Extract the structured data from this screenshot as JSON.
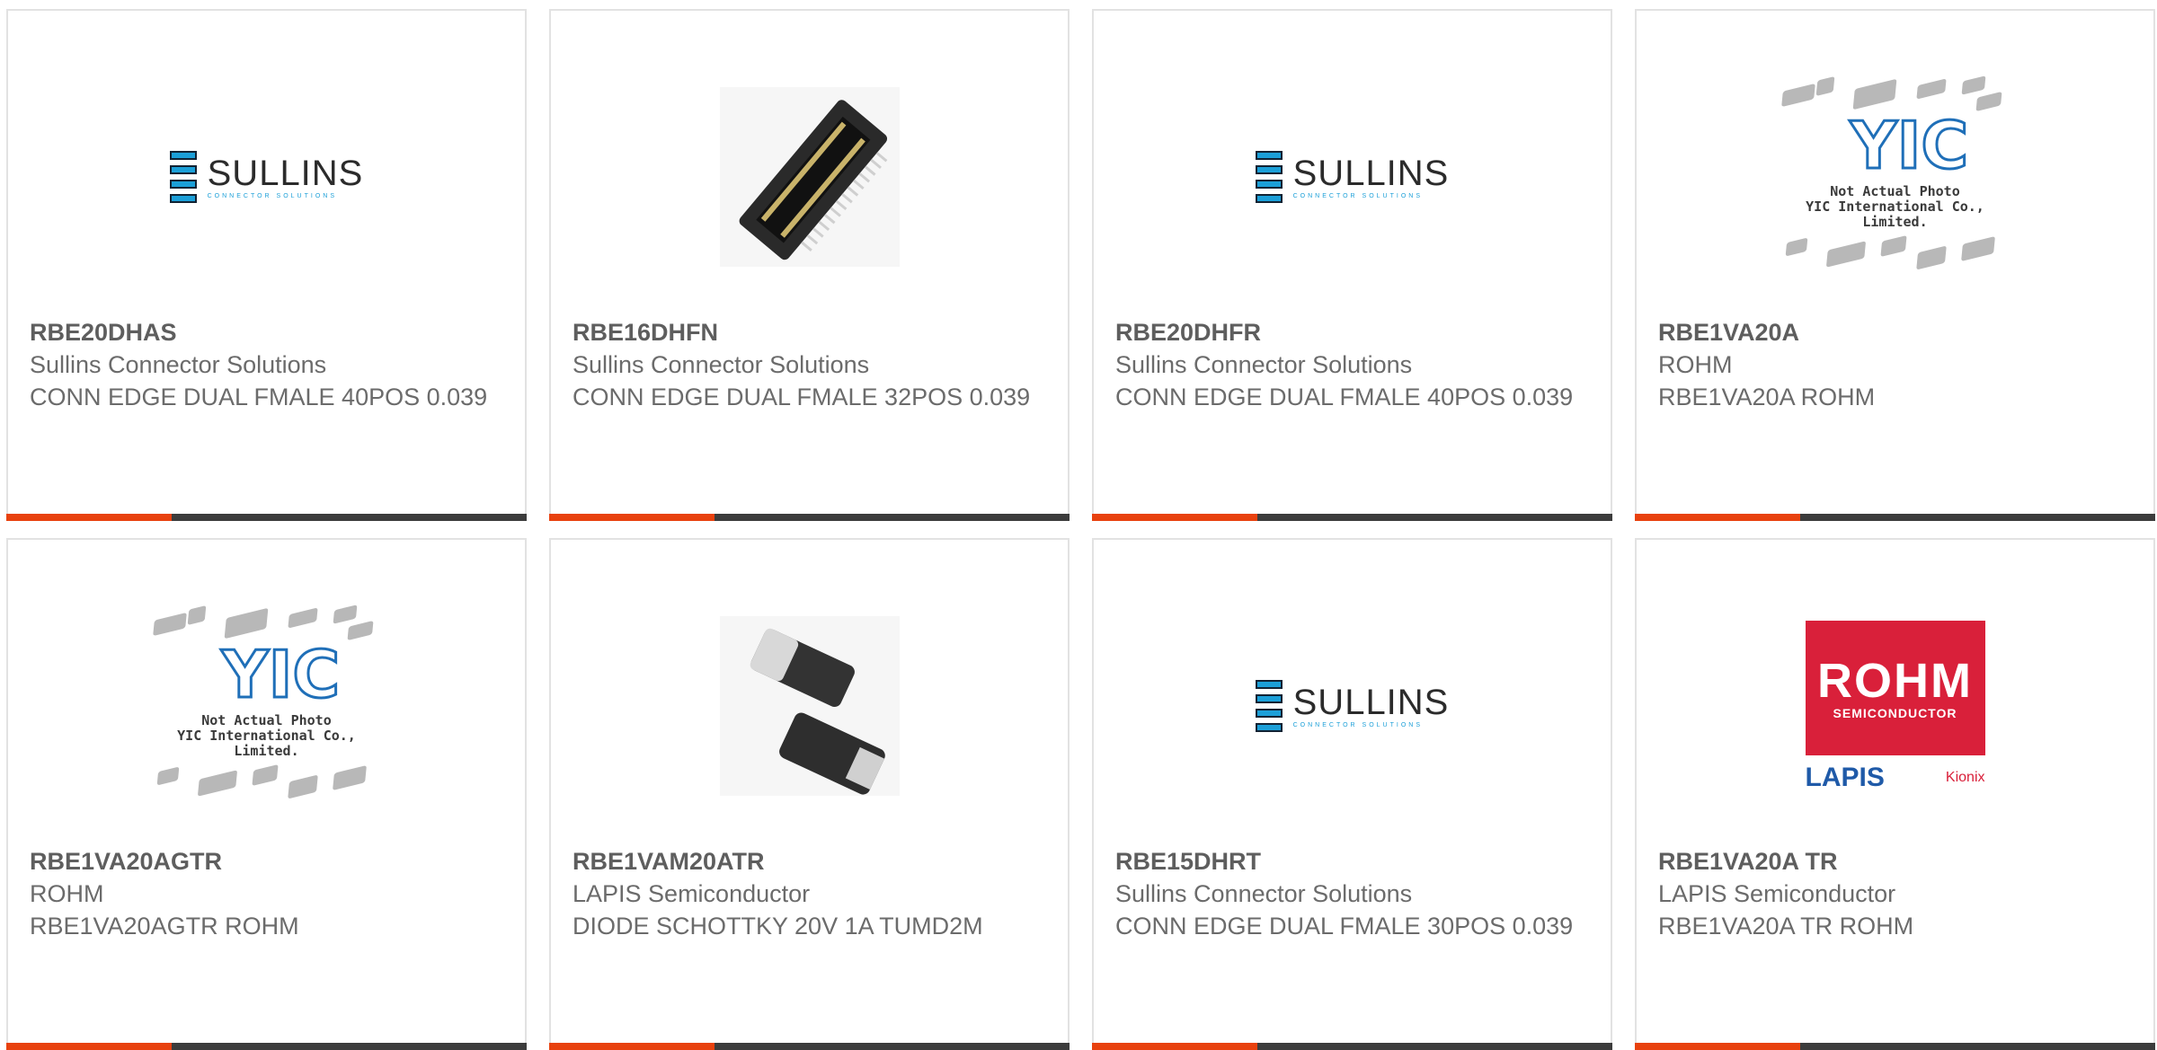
{
  "products": [
    {
      "part": "RBE20DHAS",
      "maker": "Sullins Connector Solutions",
      "desc": "CONN EDGE DUAL FMALE 40POS 0.039",
      "image": "sullins-logo"
    },
    {
      "part": "RBE16DHFN",
      "maker": "Sullins Connector Solutions",
      "desc": "CONN EDGE DUAL FMALE 32POS 0.039",
      "image": "connector-photo"
    },
    {
      "part": "RBE20DHFR",
      "maker": "Sullins Connector Solutions",
      "desc": "CONN EDGE DUAL FMALE 40POS 0.039",
      "image": "sullins-logo"
    },
    {
      "part": "RBE1VA20A",
      "maker": "ROHM",
      "desc": "RBE1VA20A ROHM",
      "image": "yic-placeholder"
    },
    {
      "part": "RBE1VA20AGTR",
      "maker": "ROHM",
      "desc": "RBE1VA20AGTR ROHM",
      "image": "yic-placeholder"
    },
    {
      "part": "RBE1VAM20ATR",
      "maker": "LAPIS Semiconductor",
      "desc": "DIODE SCHOTTKY 20V 1A TUMD2M",
      "image": "diode-photo"
    },
    {
      "part": "RBE15DHRT",
      "maker": "Sullins Connector Solutions",
      "desc": "CONN EDGE DUAL FMALE 30POS 0.039",
      "image": "sullins-logo"
    },
    {
      "part": "RBE1VA20A TR",
      "maker": "LAPIS Semiconductor",
      "desc": "RBE1VA20A TR ROHM",
      "image": "rohm-lapis-logo"
    }
  ],
  "logos": {
    "sullins_name": "SULLINS",
    "sullins_sub": "CONNECTOR SOLUTIONS",
    "yic_mark": "YIC",
    "yic_caption_1": "Not Actual Photo",
    "yic_caption_2": "YIC International Co., Limited.",
    "rohm_name": "ROHM",
    "rohm_sub": "SEMICONDUCTOR",
    "lapis_name": "LAPIS",
    "kionix_name": "Kionix"
  },
  "colors": {
    "accent": "#e8410e",
    "bar": "#3c3c3c",
    "border": "#e2e2e2",
    "sullins_blue": "#1b9fd8",
    "rohm_red": "#d9203a"
  }
}
